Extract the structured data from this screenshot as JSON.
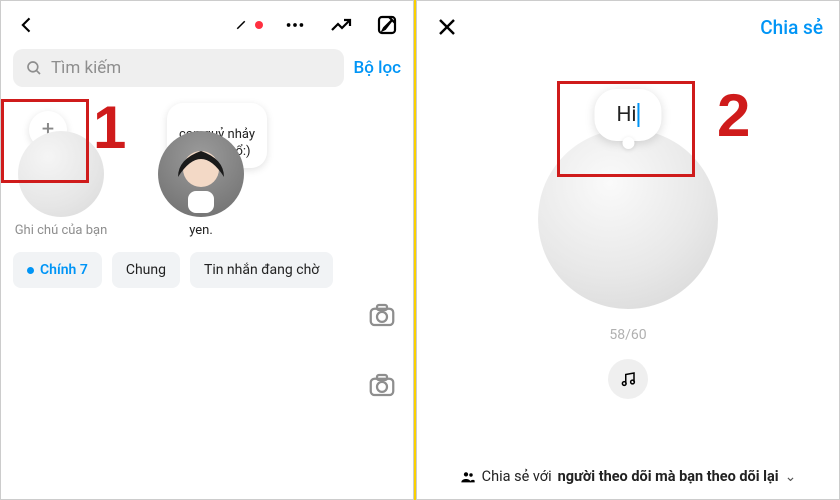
{
  "left": {
    "search_placeholder": "Tìm kiếm",
    "filter_label": "Bộ lọc",
    "notes": {
      "your_note_label": "Ghi chú của bạn",
      "add_symbol": "+",
      "friend_name": "yen.",
      "friend_note": "con quỷ nhảy\nbên cửa sổ:)"
    },
    "tabs": {
      "primary": "Chính 7",
      "general": "Chung",
      "requests": "Tin nhắn đang chờ"
    },
    "step_number": "1"
  },
  "right": {
    "share_label": "Chia sẻ",
    "note_input": "Hi",
    "char_count": "58/60",
    "footer_prefix": "Chia sẻ với ",
    "footer_bold": "người theo dõi mà bạn theo dõi lại",
    "step_number": "2"
  }
}
